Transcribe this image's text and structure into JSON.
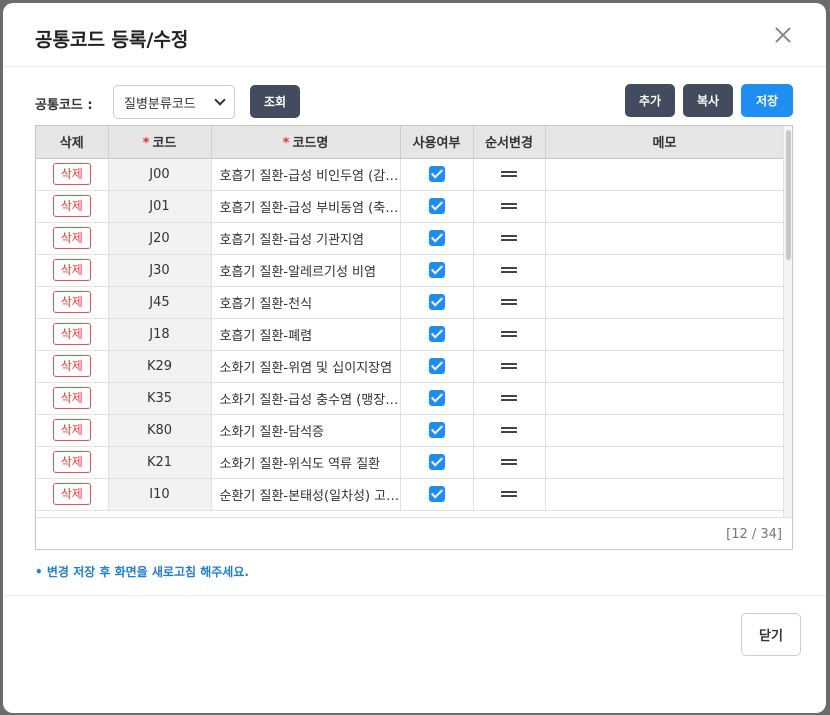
{
  "modal": {
    "title": "공통코드 등록/수정",
    "close_icon": "close-icon"
  },
  "toolbar": {
    "code_label": "공통코드 :",
    "select_value": "질병분류코드",
    "search_label": "조회",
    "add_label": "추가",
    "copy_label": "복사",
    "save_label": "저장"
  },
  "grid": {
    "headers": {
      "delete": "삭제",
      "code": "코드",
      "code_name": "코드명",
      "use_yn": "사용여부",
      "order": "순서변경",
      "memo": "메모"
    },
    "required_mark": "*",
    "delete_label": "삭제",
    "rows": [
      {
        "code": "J00",
        "name": "호흡기 질환-급성 비인두염 (감기)",
        "use": true,
        "memo": ""
      },
      {
        "code": "J01",
        "name": "호흡기 질환-급성 부비동염 (축농증)",
        "use": true,
        "memo": ""
      },
      {
        "code": "J20",
        "name": "호흡기 질환-급성 기관지염",
        "use": true,
        "memo": ""
      },
      {
        "code": "J30",
        "name": "호흡기 질환-알레르기성 비염",
        "use": true,
        "memo": ""
      },
      {
        "code": "J45",
        "name": "호흡기 질환-천식",
        "use": true,
        "memo": ""
      },
      {
        "code": "J18",
        "name": "호흡기 질환-폐렴",
        "use": true,
        "memo": ""
      },
      {
        "code": "K29",
        "name": "소화기 질환-위염 및 십이지장염",
        "use": true,
        "memo": ""
      },
      {
        "code": "K35",
        "name": "소화기 질환-급성 충수염 (맹장염)",
        "use": true,
        "memo": ""
      },
      {
        "code": "K80",
        "name": "소화기 질환-담석증",
        "use": true,
        "memo": ""
      },
      {
        "code": "K21",
        "name": "소화기 질환-위식도 역류 질환",
        "use": true,
        "memo": ""
      },
      {
        "code": "I10",
        "name": "순환기 질환-본태성(일차성) 고혈압",
        "use": true,
        "memo": ""
      }
    ],
    "count_text": "[12 / 34]"
  },
  "notice": "• 변경 저장 후 화면을 새로고침 해주세요.",
  "footer": {
    "close_label": "닫기"
  },
  "colors": {
    "primary_blue": "#1f8ef2",
    "dark_button": "#424c5e",
    "delete_red": "#e03c3c"
  }
}
